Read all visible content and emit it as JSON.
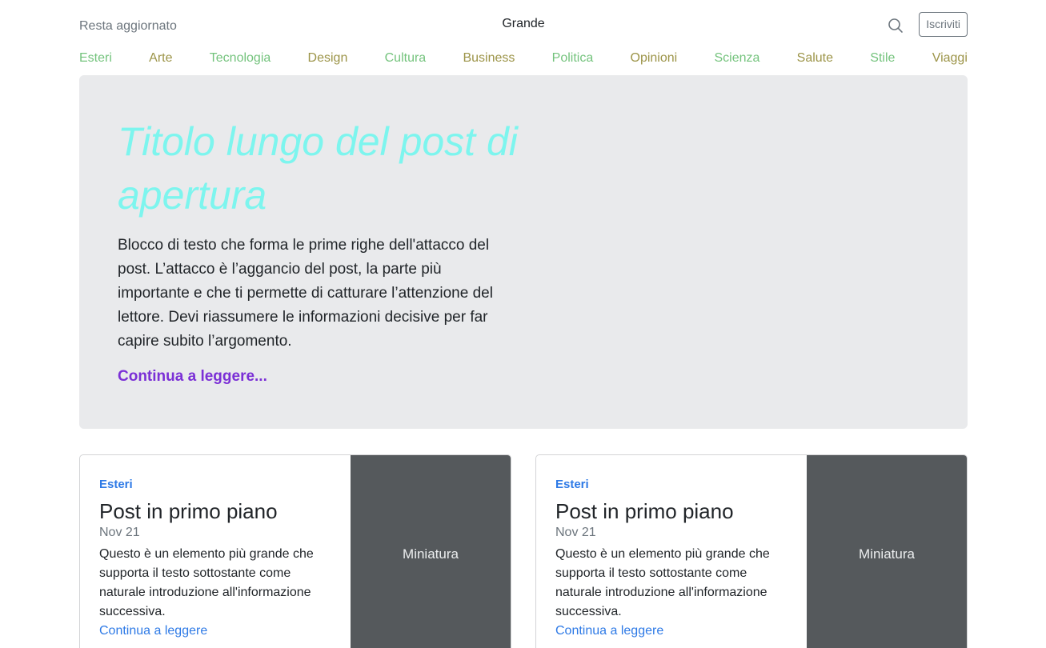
{
  "header": {
    "left_text": "Resta aggiornato",
    "title": "Grande",
    "search_icon": "search-icon",
    "subscribe_label": "Iscriviti"
  },
  "nav": {
    "items": [
      "Esteri",
      "Arte",
      "Tecnologia",
      "Design",
      "Cultura",
      "Business",
      "Politica",
      "Opinioni",
      "Scienza",
      "Salute",
      "Stile",
      "Viaggi"
    ]
  },
  "hero": {
    "title": "Titolo lungo del post di apertura",
    "text": "Blocco di testo che forma le prime righe dell'attacco del post. L’attacco è l’aggancio del post, la parte più importante e che ti permette di catturare l’attenzione del lettore. Devi riassumere le informazioni decisive per far capire subito l’argomento.",
    "link": "Continua a leggere..."
  },
  "cards": [
    {
      "category": "Esteri",
      "title": "Post in primo piano",
      "date": "Nov 21",
      "text": "Questo è un elemento più grande che supporta il testo sottostante come naturale introduzione all'informazione successiva.",
      "link": "Continua a leggere",
      "thumb_label": "Miniatura"
    },
    {
      "category": "Esteri",
      "title": "Post in primo piano",
      "date": "Nov 21",
      "text": "Questo è un elemento più grande che supporta il testo sottostante come naturale introduzione all'informazione successiva.",
      "link": "Continua a leggere",
      "thumb_label": "Miniatura"
    }
  ],
  "colors": {
    "nav_green": "#74c37d",
    "nav_olive": "#9c9448",
    "hero_bg": "#e9eaec",
    "hero_title": "#7df5ee",
    "hero_link": "#7b30d6",
    "link_blue": "#2e7ae6",
    "thumb_bg": "#55595c"
  }
}
